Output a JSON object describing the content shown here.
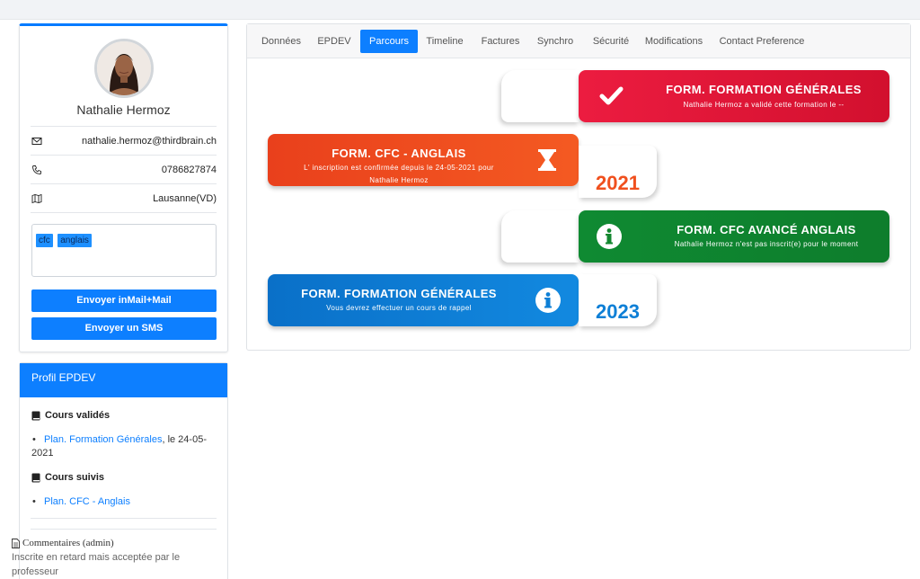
{
  "profile": {
    "name": "Nathalie Hermoz",
    "email": "nathalie.hermoz@thirdbrain.ch",
    "phone": "0786827874",
    "location": "Lausanne(VD)",
    "tags": [
      "cfc",
      "anglais"
    ],
    "send_mail_label": "Envoyer inMail+Mail",
    "send_sms_label": "Envoyer un SMS"
  },
  "epdev": {
    "header": "Profil EPDEV",
    "validated_title": "Cours validés",
    "validated_link": "Plan. Formation Générales",
    "validated_suffix": ", le 24-05-",
    "validated_suffix2": "2021",
    "followed_title": "Cours suivis",
    "followed_link": "Plan. CFC - Anglais",
    "comment_title": "Commentaires (admin)",
    "comment_line1": "Inscrite en retard mais acceptée par le",
    "comment_line2": "professeur"
  },
  "tabs": [
    "Données",
    "EPDEV",
    "Parcours",
    "Timeline",
    "Factures",
    "Synchro",
    "Sécurité",
    "Modifications",
    "Contact Preference"
  ],
  "active_tab": "Parcours",
  "timeline": [
    {
      "title": "FORM. FORMATION GÉNÉRALES",
      "desc": "Nathalie Hermoz a validé cette formation le --",
      "icon": "check-icon",
      "color": "#dc1a3a"
    },
    {
      "title": "FORM. CFC - ANGLAIS",
      "desc1": "L' inscription est confirmée depuis le 24-05-2021 pour",
      "desc2": "Nathalie Hermoz",
      "icon": "hourglass-icon",
      "year": "2021",
      "color": "#f0501e"
    },
    {
      "title": "FORM. CFC AVANCÉ ANGLAIS",
      "desc": "Nathalie Hermoz n'est pas inscrit(e) pour le moment",
      "icon": "info-circle-icon",
      "color": "#13872f"
    },
    {
      "title": "FORM. FORMATION GÉNÉRALES",
      "desc": "Vous devrez effectuer un cours de rappel",
      "icon": "info-circle-icon",
      "year": "2023",
      "color": "#0d7fd6"
    }
  ]
}
